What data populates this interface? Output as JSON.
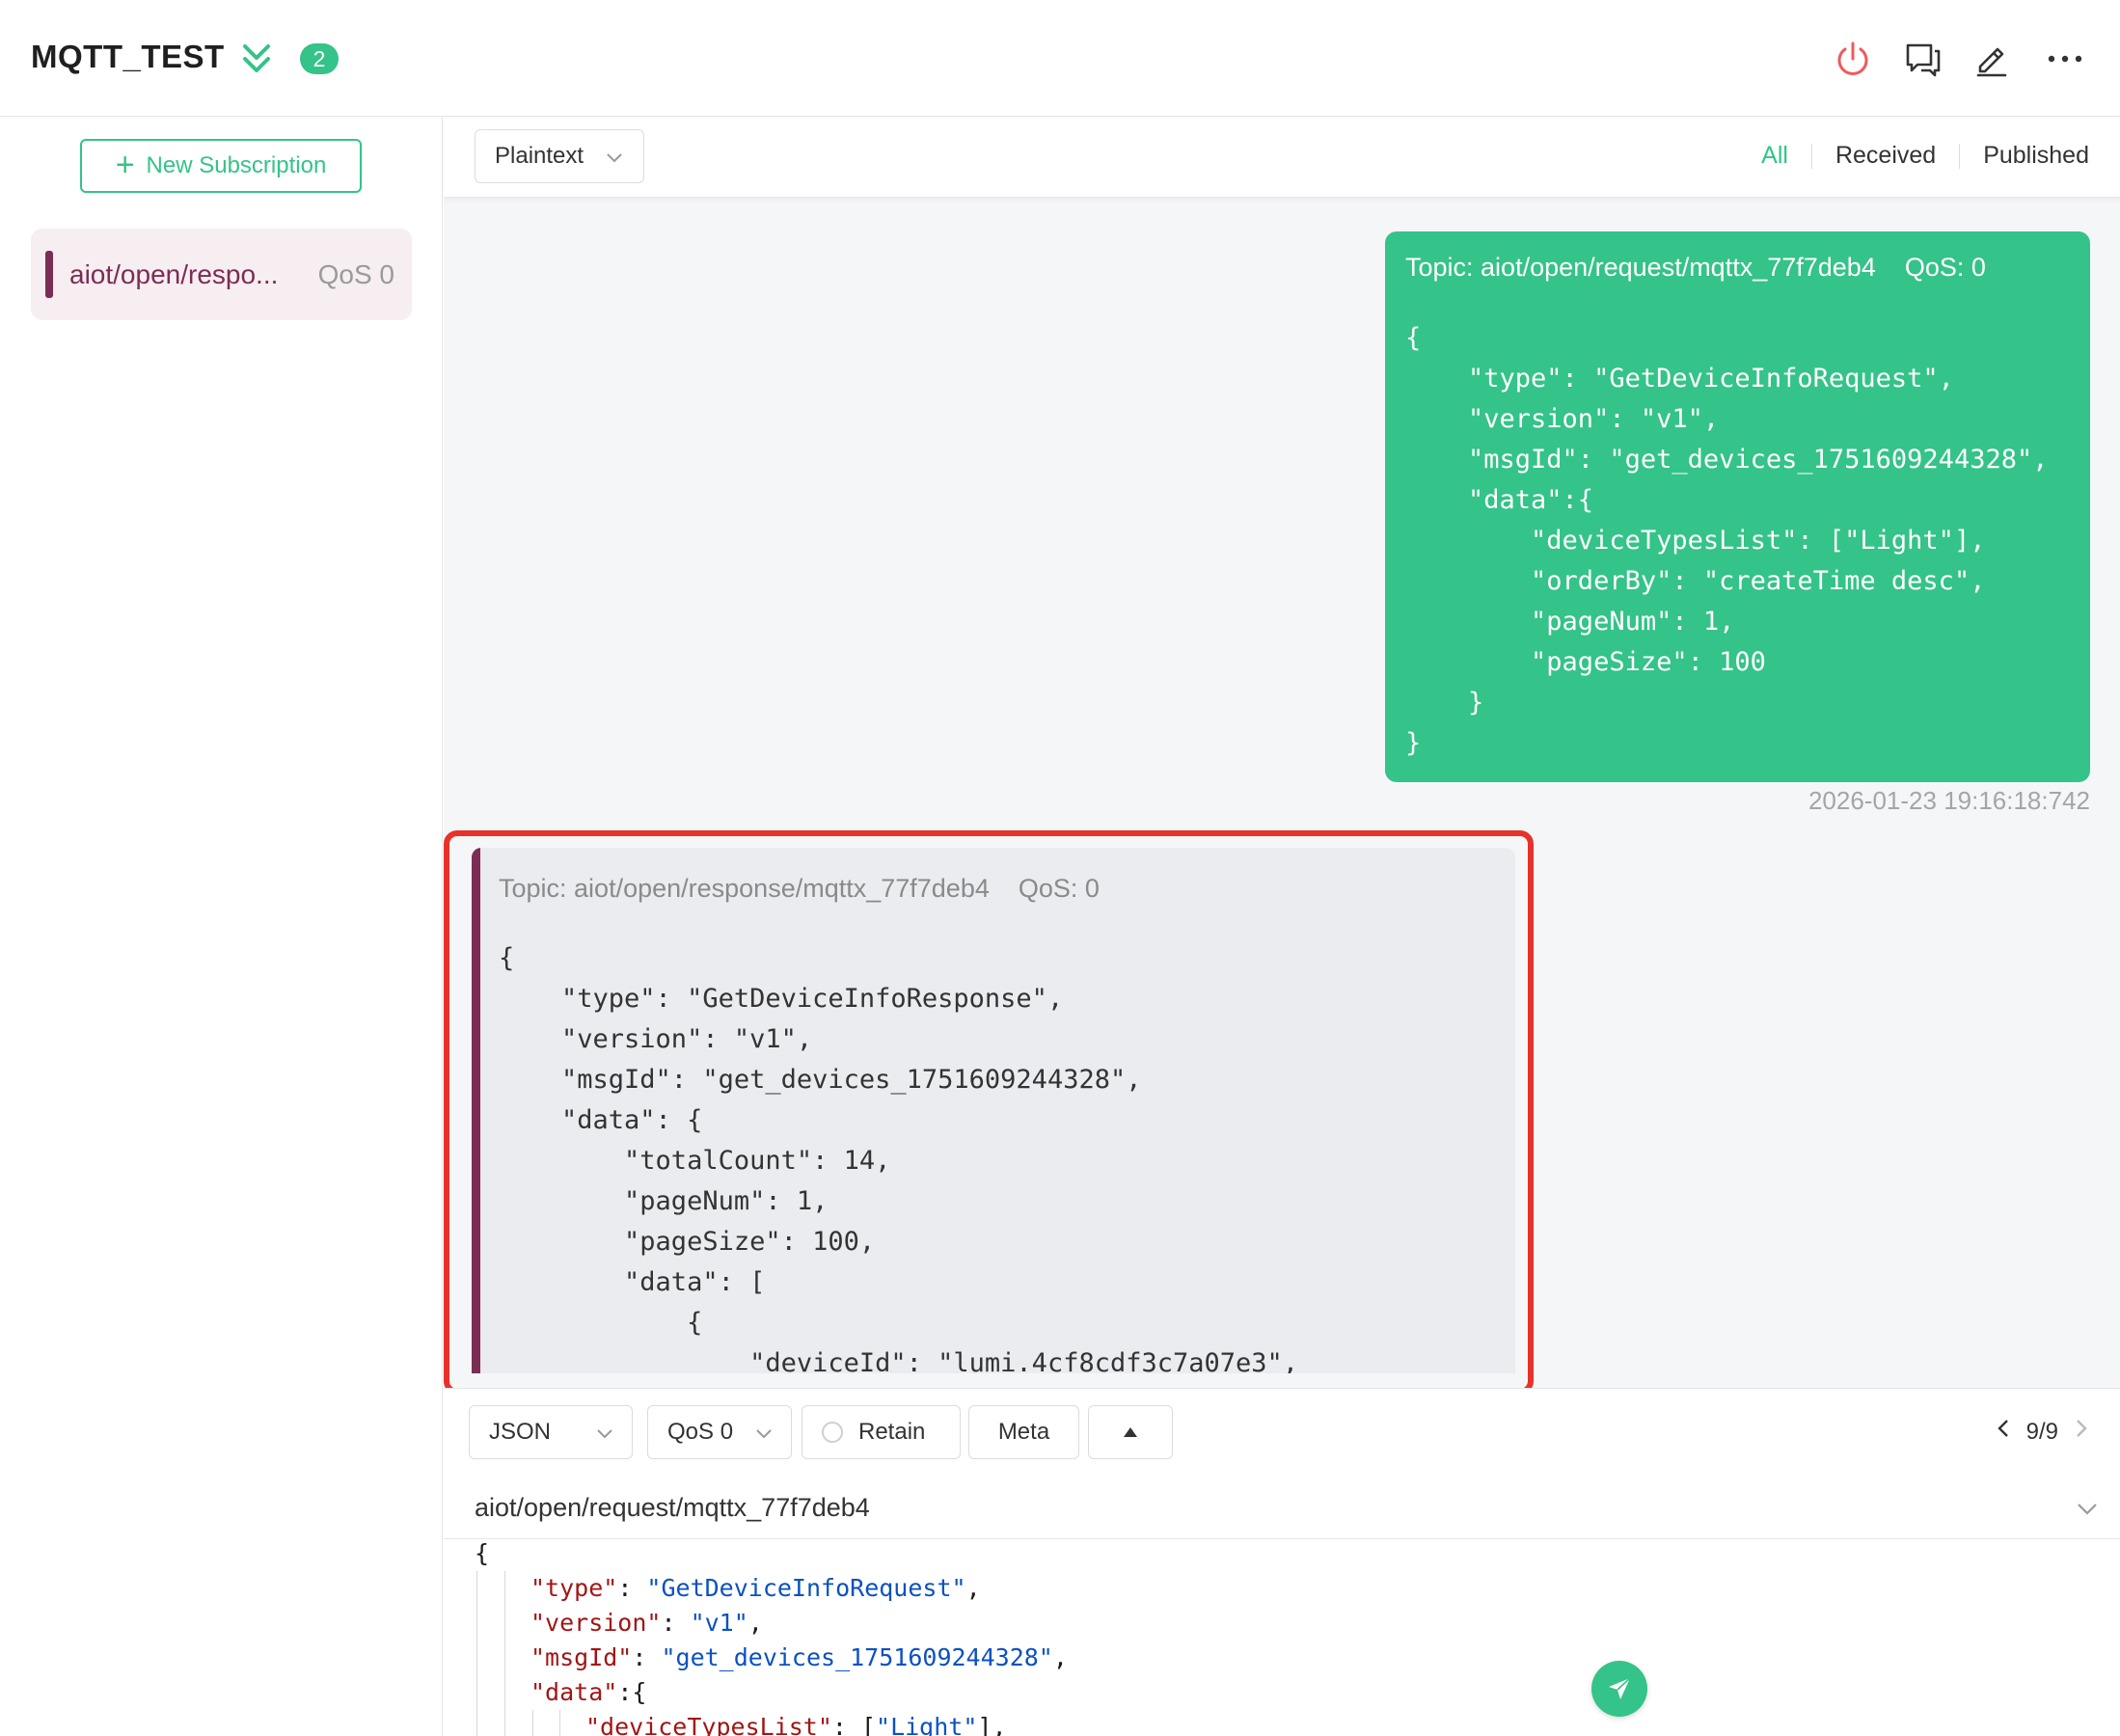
{
  "header": {
    "title": "MQTT_TEST",
    "badge_count": "2",
    "icons": [
      "collapse-icon",
      "power-icon",
      "chat-icon",
      "edit-icon",
      "more-icon"
    ]
  },
  "sidebar": {
    "new_subscription_label": "New Subscription",
    "subscriptions": [
      {
        "topic": "aiot/open/respo...",
        "qos": "QoS 0",
        "color": "#7b2d55"
      }
    ]
  },
  "toolbar": {
    "format": "Plaintext",
    "filters": {
      "all": "All",
      "received": "Received",
      "published": "Published"
    },
    "active_filter": "All"
  },
  "messages": {
    "sent": {
      "meta": "Topic: aiot/open/request/mqttx_77f7deb4    QoS: 0",
      "body": "{\n    \"type\": \"GetDeviceInfoRequest\",\n    \"version\": \"v1\",\n    \"msgId\": \"get_devices_1751609244328\",\n    \"data\":{\n        \"deviceTypesList\": [\"Light\"],\n        \"orderBy\": \"createTime desc\",\n        \"pageNum\": 1,\n        \"pageSize\": 100\n    }\n}",
      "time": "2026-01-23 19:16:18:742"
    },
    "received": {
      "meta": "Topic: aiot/open/response/mqttx_77f7deb4    QoS: 0",
      "body": "{\n    \"type\": \"GetDeviceInfoResponse\",\n    \"version\": \"v1\",\n    \"msgId\": \"get_devices_1751609244328\",\n    \"data\": {\n        \"totalCount\": 14,\n        \"pageNum\": 1,\n        \"pageSize\": 100,\n        \"data\": [\n            {\n                \"deviceId\": \"lumi.4cf8cdf3c7a07e3\","
    }
  },
  "composer": {
    "payload_format": "JSON",
    "qos": "QoS 0",
    "retain_label": "Retain",
    "meta_label": "Meta",
    "pager": "9/9",
    "topic": "aiot/open/request/mqttx_77f7deb4",
    "editor": {
      "l0": "{",
      "l1_key": "\"type\"",
      "l1_val": "\"GetDeviceInfoRequest\"",
      "l2_key": "\"version\"",
      "l2_val": "\"v1\"",
      "l3_key": "\"msgId\"",
      "l3_val": "\"get_devices_1751609244328\"",
      "l4_key": "\"data\"",
      "l5_key": "\"deviceTypesList\"",
      "l5_val": "\"Light\""
    }
  },
  "colors": {
    "accent": "#34c388",
    "subscription": "#7b2d55",
    "highlight": "#e8312b"
  }
}
